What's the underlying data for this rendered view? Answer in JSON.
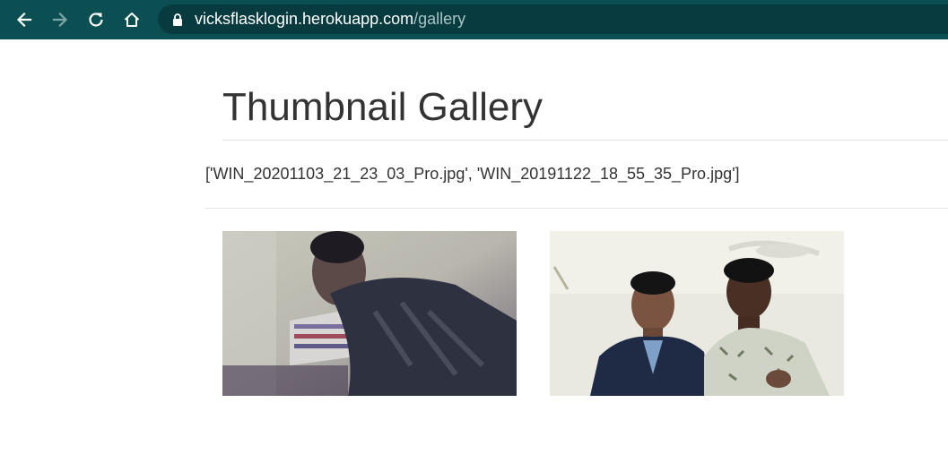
{
  "browser": {
    "url_host": "vicksflasklogin.herokuapp.com",
    "url_path": "/gallery",
    "icons": [
      "back-arrow-icon",
      "forward-arrow-icon",
      "reload-icon",
      "home-icon",
      "lock-icon"
    ],
    "colors": {
      "toolbar": "#0b4f53",
      "omnibox": "#083b3f",
      "url_path": "#a9c3c5"
    }
  },
  "page": {
    "title": "Thumbnail Gallery",
    "file_list": "['WIN_20201103_21_23_03_Pro.jpg', 'WIN_20191122_18_55_35_Pro.jpg']",
    "thumbnails": [
      {
        "file": "WIN_20201103_21_23_03_Pro.jpg"
      },
      {
        "file": "WIN_20191122_18_55_35_Pro.jpg"
      }
    ]
  }
}
